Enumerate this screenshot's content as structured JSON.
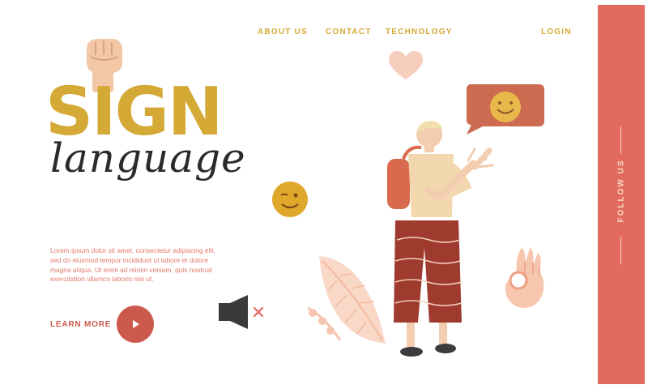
{
  "nav": {
    "about": "ABOUT US",
    "contact": "CONTACT",
    "technology": "TECHNOLOGY",
    "login": "LOGIN"
  },
  "sidebar": {
    "follow": "FOLLOW US"
  },
  "hero": {
    "title_main": "SIGN",
    "title_script": "language",
    "body": "Lorem ipsum dolor sit amet, consectetur adipiscing elit, sed do eiusmod tempor incididunt ut labore et dolore magna aliqua. Ut enim ad minim veniam, quis nostrud exercitation ullamco laboris nisi ut.",
    "cta": "LEARN MORE"
  },
  "colors": {
    "accent_yellow": "#d4a935",
    "accent_red": "#e26a5e",
    "button_red": "#cc5a4c",
    "text_dark": "#2a2a2a"
  },
  "icons": [
    "fist-icon",
    "heart-icon",
    "smile-emoji-icon",
    "wink-emoji-icon",
    "muted-speaker-icon",
    "ok-hand-icon",
    "play-icon"
  ]
}
